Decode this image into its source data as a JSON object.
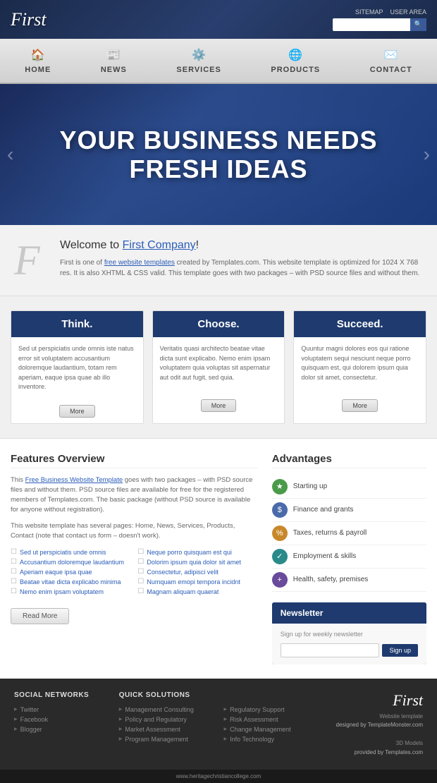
{
  "header": {
    "logo": "First",
    "links": [
      "SITEMAP",
      "USER AREA"
    ],
    "search_placeholder": ""
  },
  "nav": {
    "items": [
      {
        "label": "HOME",
        "icon": "🏠"
      },
      {
        "label": "NEWS",
        "icon": "📰"
      },
      {
        "label": "SERVICES",
        "icon": "⚙️"
      },
      {
        "label": "PRODUCTS",
        "icon": "🌐"
      },
      {
        "label": "CONTACT",
        "icon": "✉️"
      }
    ]
  },
  "hero": {
    "line1": "YOUR BUSINESS NEEDS",
    "line2": "FRESH IDEAS"
  },
  "welcome": {
    "letter": "F",
    "heading_prefix": "Welcome to ",
    "heading_highlight": "First Company",
    "heading_suffix": "!",
    "body": "First is one of free website templates created by Templates.com. This website template is optimized for 1024 X 768 res. It is also XHTML & CSS valid. This template goes with two packages – with PSD source files and without them.",
    "link_text": "free website templates"
  },
  "cards": [
    {
      "title": "Think.",
      "body": "Sed ut perspiciatis unde omnis iste natus error sit voluptatem accusantium doloremque laudantium, totam rem aperiam, eaque ipsa quae ab illo inventore.",
      "btn": "More"
    },
    {
      "title": "Choose.",
      "body": "Veritatis quasi architecto beatae vitae dicta sunt explicabo. Nemo enim ipsam voluptatem quia voluptas sit aspernatur aut odit aut fugit, sed quia.",
      "btn": "More"
    },
    {
      "title": "Succeed.",
      "body": "Quuntur magni dolores eos qui ratione voluptatem sequi nesciunt neque porro quisquam est, qui dolorem ipsum quia dolor sit amet, consectetur.",
      "btn": "More"
    }
  ],
  "features": {
    "title": "Features Overview",
    "para1": "This Free Business Website Template goes with two packages – with PSD source files and without them. PSD source files are available for free for the registered members of Templates.com. The basic package (without PSD source is available for anyone without registration).",
    "para2": "This website template has several pages: Home, News, Services, Products, Contact (note that contact us form – doesn't work).",
    "list": [
      "Sed ut perspiciatis unde omnis",
      "Accusantium doloremque laudantium",
      "Aperiam eaque ipsa quae",
      "Beatae vitae dicta explicabo minima",
      "Nemo enim ipsam voluptatem",
      "Neque porro quisquam est qui",
      "Dolorim ipsum quia dolor sit amet",
      "Consectetur, adipisci velit",
      "Numquam emopi tempora incidnt",
      "Magnam aliquam quaerat"
    ],
    "read_more": "Read More"
  },
  "advantages": {
    "title": "Advantages",
    "items": [
      {
        "label": "Starting up",
        "color": "green"
      },
      {
        "label": "Finance and grants",
        "color": "blue"
      },
      {
        "label": "Taxes, returns & payroll",
        "color": "orange"
      },
      {
        "label": "Employment & skills",
        "color": "teal"
      },
      {
        "label": "Health, safety, premises",
        "color": "purple"
      }
    ]
  },
  "newsletter": {
    "title": "Newsletter",
    "desc": "Sign up for weekly newsletter",
    "btn": "Sign up",
    "placeholder": ""
  },
  "footer": {
    "cols": [
      {
        "title": "Social Networks",
        "items": [
          "Twitter",
          "Facebook",
          "Blogger"
        ]
      },
      {
        "title": "Quick Solutions",
        "items": [
          "Management Consulting",
          "Policy and Regulatory",
          "Market Assessment",
          "Program Management"
        ]
      },
      {
        "title": "",
        "items": [
          "Regulatory Support",
          "Risk Assessment",
          "Change Management",
          "Info Technology"
        ]
      }
    ],
    "logo": "First",
    "logo_lines": [
      "Website template",
      "designed by TemplateMonster.com",
      "",
      "3D Models",
      "provided by Templates.com"
    ],
    "watermark": "www.heritagechristiancollege.com"
  }
}
